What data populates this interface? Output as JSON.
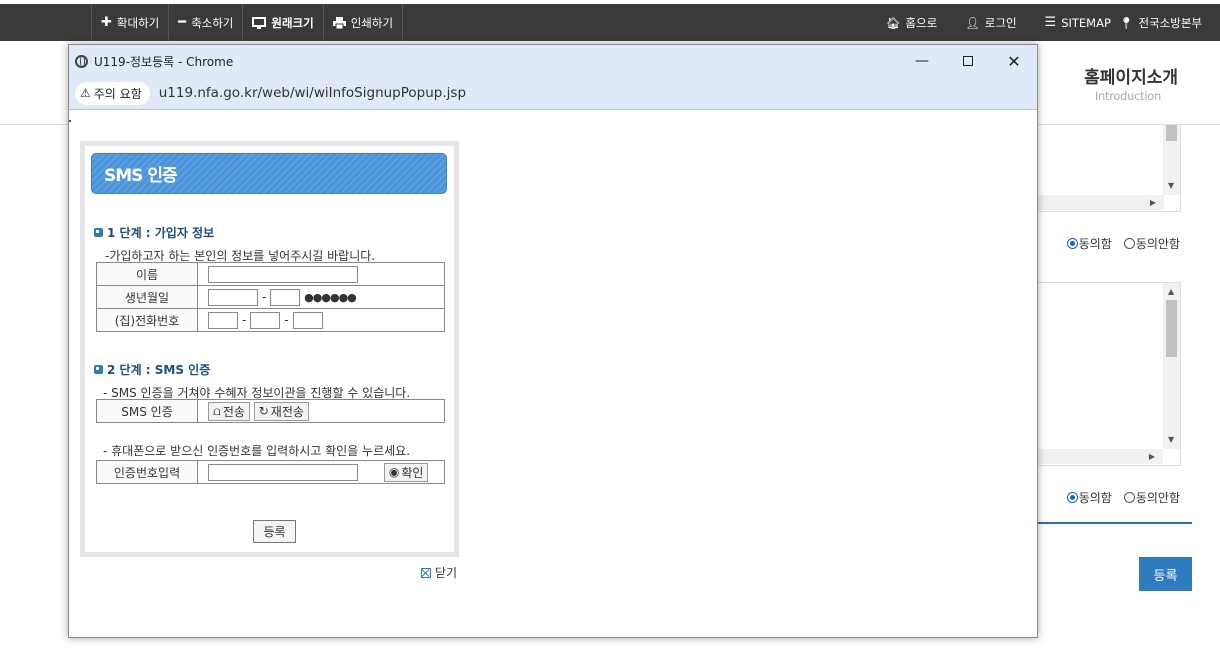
{
  "toolbar": {
    "zoom_in": "확대하기",
    "zoom_out": "축소하기",
    "original": "원래크기",
    "print": "인쇄하기",
    "home": "홈으로",
    "login": "로그인",
    "sitemap": "SITEMAP",
    "hq": "전국소방본부"
  },
  "page": {
    "intro_title": "홈페이지소개",
    "intro_sub": "Introduction",
    "agree": "동의함",
    "disagree": "동의안함",
    "register": "등록"
  },
  "popup": {
    "window_title": "U119-정보등록 - Chrome",
    "warning": "주의 요함",
    "url": "u119.nfa.go.kr/web/wi/wiInfoSignupPopup.jsp",
    "sms_title": "SMS 인증",
    "step1_title": "1 단계 : 가입자 정보",
    "step1_desc": "-가입하고자 하는 본인의 정보를 넣어주시길 바랍니다.",
    "name_label": "이름",
    "birth_label": "생년월일",
    "birth_mask": "●●●●●●",
    "phone_label": "(집)전화번호",
    "step2_title": "2 단계 : SMS 인증",
    "step2_desc": "- SMS 인증을 거쳐야 수혜자 정보이관을 진행할 수 있습니다.",
    "sms_label": "SMS 인증",
    "send": "전송",
    "resend": "재전송",
    "code_desc": "- 휴대폰으로 받으신 인증번호를 입력하시고 확인을 누르세요.",
    "code_label": "인증번호입력",
    "confirm": "확인",
    "register": "등록",
    "close": "닫기"
  },
  "colors": {
    "accent": "#2e7bbd",
    "header_blue": "#4c93d9",
    "toolbar": "#3a3a3a"
  }
}
